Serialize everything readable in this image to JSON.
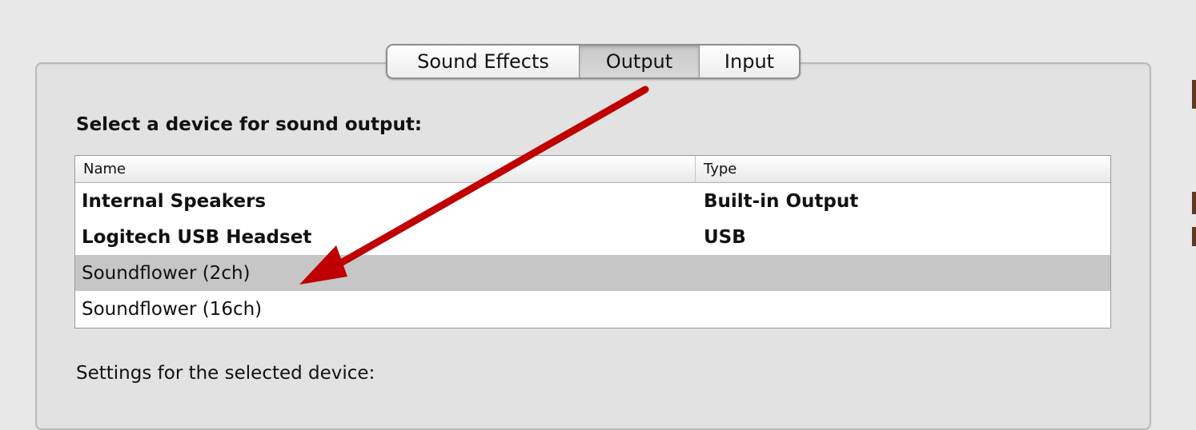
{
  "tabs": [
    {
      "label": "Sound Effects",
      "selected": false
    },
    {
      "label": "Output",
      "selected": true
    },
    {
      "label": "Input",
      "selected": false
    }
  ],
  "heading": "Select a device for sound output:",
  "table": {
    "columns": [
      "Name",
      "Type"
    ],
    "rows": [
      {
        "name": "Internal Speakers",
        "type": "Built-in Output",
        "selected": false
      },
      {
        "name": "Logitech USB Headset",
        "type": "USB",
        "selected": false
      },
      {
        "name": "Soundflower (2ch)",
        "type": "",
        "selected": true
      },
      {
        "name": "Soundflower (16ch)",
        "type": "",
        "selected": false
      }
    ]
  },
  "settings_label": "Settings for the selected device:",
  "annotation": {
    "arrow_color": "#c00000"
  },
  "colors": {
    "selected_row": "#c6c6c6",
    "background": "#e8e8e8"
  }
}
